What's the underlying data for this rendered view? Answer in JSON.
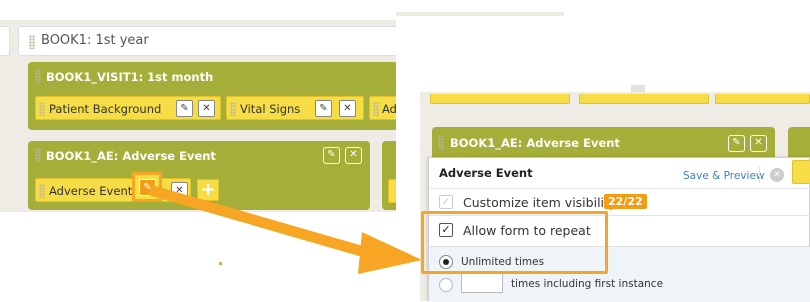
{
  "book": {
    "title": "BOOK1: 1st year"
  },
  "visit": {
    "title": "BOOK1_VISIT1: 1st month",
    "forms": [
      {
        "label": "Patient Background"
      },
      {
        "label": "Vital Signs"
      },
      {
        "label": "Ad"
      }
    ]
  },
  "adverse_event_group": {
    "title": "BOOK1_AE: Adverse Event",
    "form_label": "Adverse Event"
  },
  "popup": {
    "title": "Adverse Event",
    "save_preview": "Save & Preview",
    "customize_label": "Customize item visibility",
    "customize_count": "22/22",
    "allow_repeat_label": "Allow form to repeat",
    "allow_repeat_checked": true,
    "unlimited_label": "Unlimited times",
    "limited_label": "times including first instance"
  },
  "colors": {
    "group_green": "#a4ae38",
    "chip_yellow": "#f6dd45",
    "highlight_orange": "#f6a623",
    "badge_orange": "#f39c12",
    "link_blue": "#3a7fbf"
  },
  "icons": [
    "pencil-icon",
    "close-icon",
    "plus-icon",
    "grip-icon",
    "close-circle-icon"
  ]
}
